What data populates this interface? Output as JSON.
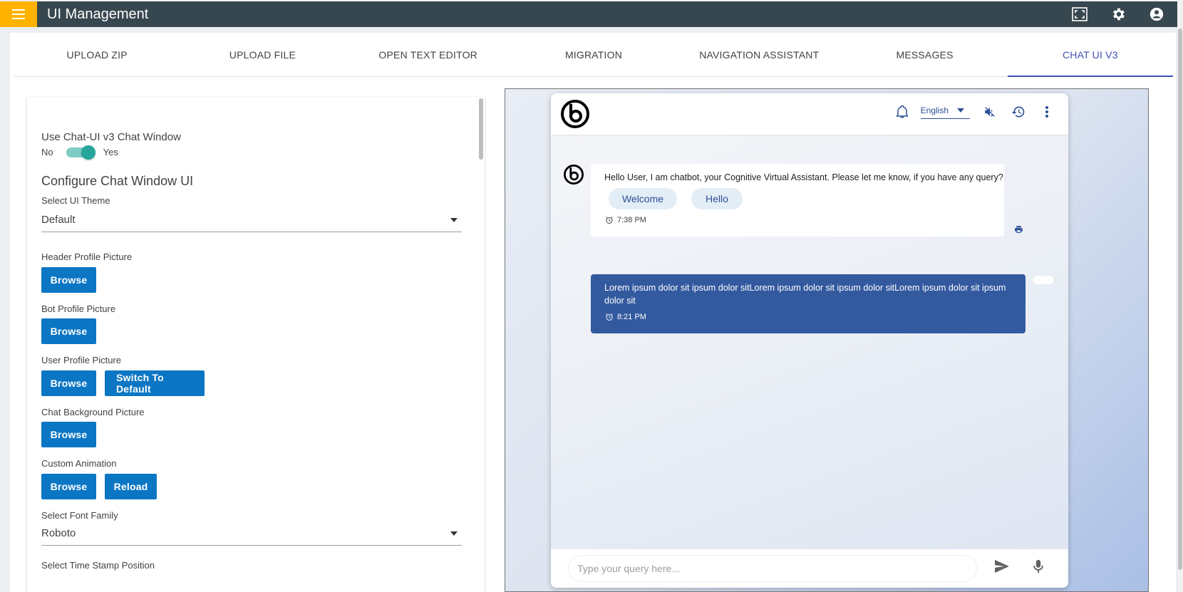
{
  "app": {
    "title": "UI Management"
  },
  "icons": {
    "menu": "menu-icon",
    "fullscreen": "fullscreen-icon",
    "settings": "gear-icon",
    "account": "account-icon"
  },
  "tabs": [
    {
      "label": "UPLOAD ZIP"
    },
    {
      "label": "UPLOAD FILE"
    },
    {
      "label": "OPEN TEXT EDITOR"
    },
    {
      "label": "MIGRATION"
    },
    {
      "label": "NAVIGATION ASSISTANT"
    },
    {
      "label": "MESSAGES"
    },
    {
      "label": "CHAT UI V3",
      "active": true
    }
  ],
  "config": {
    "use_chat_label": "Use Chat-UI v3 Chat Window",
    "toggle_no": "No",
    "toggle_yes": "Yes",
    "section_title": "Configure Chat Window UI",
    "theme_label": "Select UI Theme",
    "theme_value": "Default",
    "header_pic_label": "Header Profile Picture",
    "bot_pic_label": "Bot Profile Picture",
    "user_pic_label": "User Profile Picture",
    "bg_pic_label": "Chat Background Picture",
    "animation_label": "Custom Animation",
    "font_label": "Select Font Family",
    "font_value": "Roboto",
    "cut_label": "Select Time Stamp Position",
    "browse": "Browse",
    "switch_default": "Switch To Default",
    "reload": "Reload"
  },
  "chat": {
    "language": "English",
    "bot_message": "Hello User, I am chatbot, your Cognitive Virtual Assistant. Please let me know, if you have any query?",
    "chips": [
      "Welcome",
      "Hello"
    ],
    "bot_time": "7:38 PM",
    "user_message": "Lorem ipsum dolor sit ipsum dolor sitLorem ipsum dolor sit ipsum dolor sitLorem ipsum dolor sit ipsum dolor sit",
    "user_time": "8:21 PM",
    "input_placeholder": "Type your query here..."
  },
  "colors": {
    "topbar": "#37474f",
    "menu": "#ffb300",
    "accent": "#3f51b5",
    "button": "#0b76c4",
    "toggle": "#26a69a",
    "user_bubble": "#33599f"
  }
}
